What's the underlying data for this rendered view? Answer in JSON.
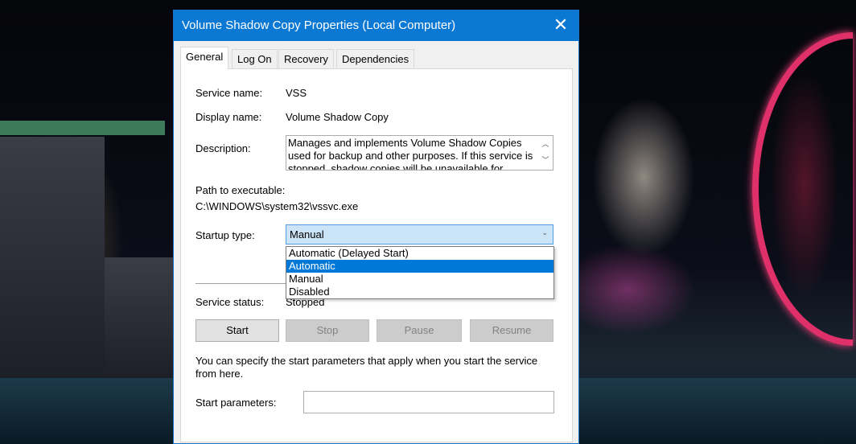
{
  "dialog": {
    "title": "Volume Shadow Copy Properties (Local Computer)"
  },
  "tabs": [
    "General",
    "Log On",
    "Recovery",
    "Dependencies"
  ],
  "general": {
    "service_name_label": "Service name:",
    "service_name": "VSS",
    "display_name_label": "Display name:",
    "display_name": "Volume Shadow Copy",
    "description_label": "Description:",
    "description": "Manages and implements Volume Shadow Copies used for backup and other purposes. If this service is stopped, shadow copies will be unavailable for",
    "path_label": "Path to executable:",
    "path": "C:\\WINDOWS\\system32\\vssvc.exe",
    "startup_label": "Startup type:",
    "startup_value": "Manual",
    "startup_options": [
      "Automatic (Delayed Start)",
      "Automatic",
      "Manual",
      "Disabled"
    ],
    "status_label": "Service status:",
    "status": "Stopped",
    "buttons": {
      "start": "Start",
      "stop": "Stop",
      "pause": "Pause",
      "resume": "Resume"
    },
    "hint": "You can specify the start parameters that apply when you start the service from here.",
    "params_label": "Start parameters:",
    "params_value": ""
  }
}
